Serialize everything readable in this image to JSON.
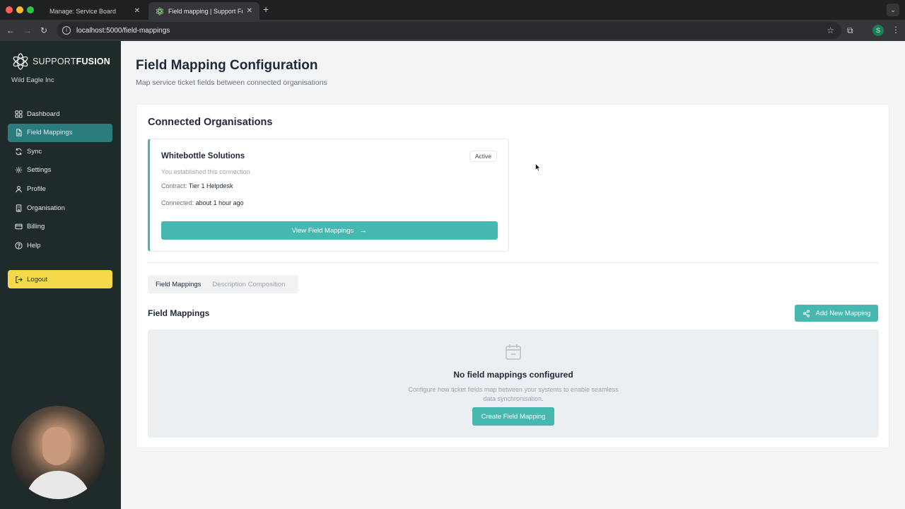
{
  "browser": {
    "tabs": [
      {
        "label": "Manage: Service Board",
        "active": false
      },
      {
        "label": "Field mapping | Support Fusion",
        "active": true
      }
    ],
    "new_tab": "+",
    "close_glyph": "✕",
    "tab_menu_glyph": "⌄",
    "url": "localhost:5000/field-mappings",
    "profile_initial": "S",
    "nav_back": "←",
    "nav_forward": "→",
    "nav_reload": "↻",
    "star": "☆",
    "ext": "⧉",
    "kebab": "⋮",
    "info": "i"
  },
  "sidebar": {
    "brand_thin": "SUPPORT",
    "brand_bold": "FUSION",
    "org": "Wild Eagle Inc",
    "items": [
      {
        "label": "Dashboard",
        "icon": "grid-icon",
        "active": false
      },
      {
        "label": "Field Mappings",
        "icon": "document-icon",
        "active": true
      },
      {
        "label": "Sync",
        "icon": "refresh-icon",
        "active": false
      },
      {
        "label": "Settings",
        "icon": "gear-icon",
        "active": false
      },
      {
        "label": "Profile",
        "icon": "user-icon",
        "active": false
      },
      {
        "label": "Organisation",
        "icon": "building-icon",
        "active": false
      },
      {
        "label": "Billing",
        "icon": "credit-card-icon",
        "active": false
      },
      {
        "label": "Help",
        "icon": "help-circle-icon",
        "active": false
      }
    ],
    "logout": "Logout"
  },
  "main": {
    "title": "Field Mapping Configuration",
    "subtitle": "Map service ticket fields between connected organisations",
    "connected_title": "Connected Organisations",
    "org_card": {
      "name": "Whitebottle Solutions",
      "badge": "Active",
      "note": "You established this connection",
      "contract_label": "Contract:",
      "contract_value": "Tier 1 Helpdesk",
      "connected_label": "Connected:",
      "connected_value": "about 1 hour ago",
      "view_button": "View Field Mappings",
      "arrow": "→"
    },
    "tabs": [
      {
        "label": "Field Mappings",
        "active": true
      },
      {
        "label": "Description Composition",
        "active": false
      }
    ],
    "field_mappings_title": "Field Mappings",
    "add_button": "Add New Mapping",
    "empty": {
      "title": "No field mappings configured",
      "description": "Configure how ticket fields map between your systems to enable seamless data synchronisation.",
      "button": "Create Field Mapping"
    }
  },
  "colors": {
    "accent": "#47b8b0",
    "sidebar_bg": "#1f2a2b",
    "sidebar_active": "#2b7c7c",
    "logout_bg": "#f5d94a"
  }
}
